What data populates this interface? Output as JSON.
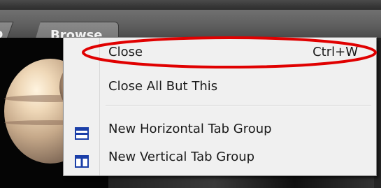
{
  "tabs": {
    "previous_label": "o",
    "active_label": "Browse"
  },
  "context_menu": {
    "items": [
      {
        "label": "Close",
        "shortcut": "Ctrl+W",
        "icon": null
      },
      {
        "label": "Close All But This",
        "shortcut": "",
        "icon": null
      },
      {
        "label": "New Horizontal Tab Group",
        "shortcut": "",
        "icon": "horizontal-tab-group-icon"
      },
      {
        "label": "New Vertical Tab Group",
        "shortcut": "",
        "icon": "vertical-tab-group-icon"
      }
    ]
  },
  "colors": {
    "highlight": "#e00000",
    "icon_blue": "#1b3fa8",
    "menu_background": "#f0f0f0"
  }
}
